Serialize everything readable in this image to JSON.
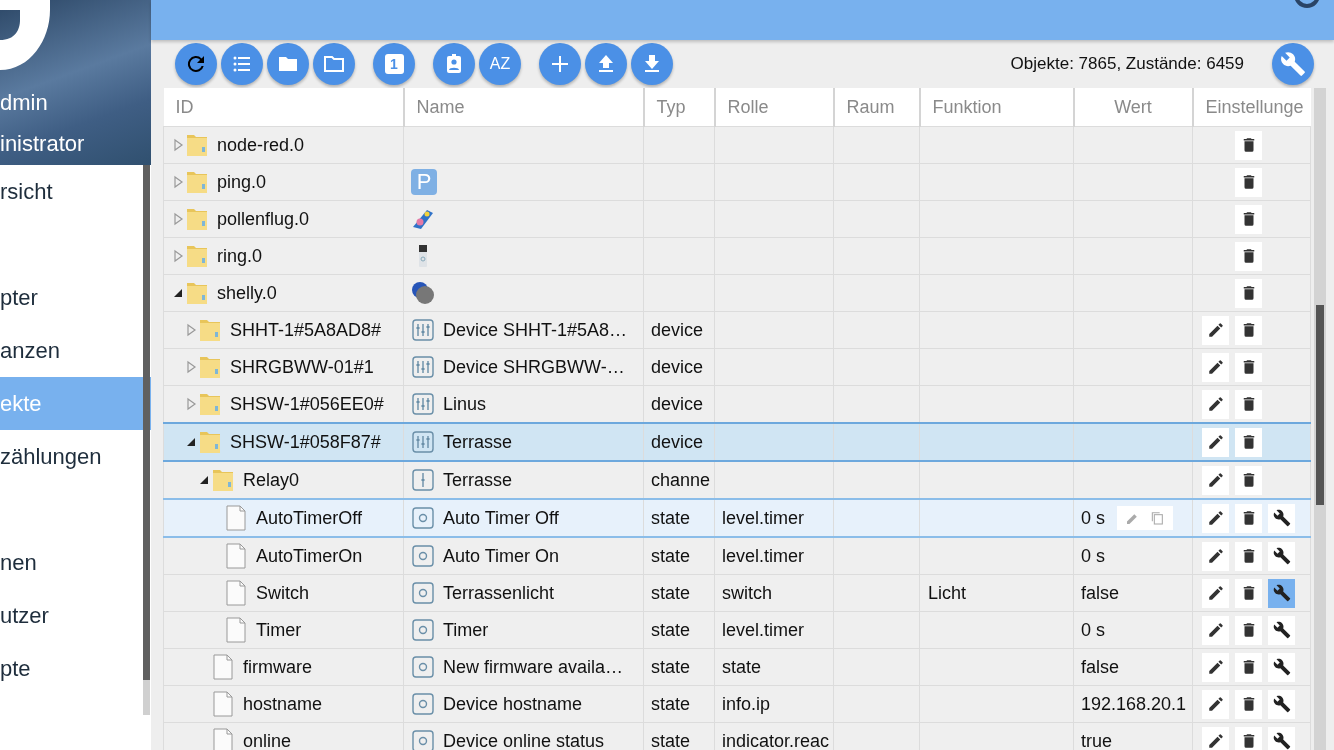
{
  "profile": {
    "name": "dmin",
    "role": "inistrator"
  },
  "menu": [
    {
      "label": "rsicht",
      "selected": false
    },
    {
      "selected": false
    },
    {
      "label": "pter",
      "selected": false
    },
    {
      "label": "anzen",
      "selected": false
    },
    {
      "label": "ekte",
      "selected": true
    },
    {
      "label": "zählungen",
      "selected": false
    },
    {
      "selected": false
    },
    {
      "label": "nen",
      "selected": false
    },
    {
      "label": "utzer",
      "selected": false
    },
    {
      "label": "pte",
      "selected": false
    }
  ],
  "toolbar": {
    "badge_label": "1",
    "sort_label": "AZ"
  },
  "stats": "Objekte: 7865, Zustände: 6459",
  "columns": [
    "ID",
    "Name",
    "Typ",
    "Rolle",
    "Raum",
    "Funktion",
    "Wert",
    "Einstellunge"
  ],
  "tree": [
    {
      "id": "node-red.0",
      "kind": "adapter",
      "expanded": false,
      "selected": false,
      "focused": false
    },
    {
      "id": "ping.0",
      "kind": "adapter",
      "expanded": false,
      "selected": false,
      "focused": false,
      "icon_label": "P"
    },
    {
      "id": "pollenflug.0",
      "kind": "adapter",
      "expanded": false,
      "selected": false,
      "focused": false
    },
    {
      "id": "ring.0",
      "kind": "adapter",
      "expanded": false,
      "selected": false,
      "focused": false
    },
    {
      "id": "shelly.0",
      "kind": "adapter",
      "expanded": true,
      "selected": false,
      "focused": false,
      "children": [
        {
          "id": "SHHT-1#5A8AD8#",
          "name": "Device SHHT-1#5A8…",
          "type": "device",
          "kind": "device",
          "expanded": false,
          "selected": false,
          "focused": false
        },
        {
          "id": "SHRGBWW-01#1",
          "name": "Device SHRGBWW-…",
          "type": "device",
          "kind": "device",
          "expanded": false,
          "selected": false,
          "focused": false
        },
        {
          "id": "SHSW-1#056EE0#",
          "name": "Linus",
          "type": "device",
          "kind": "device",
          "expanded": false,
          "selected": false,
          "focused": false
        },
        {
          "id": "SHSW-1#058F87#",
          "name": "Terrasse",
          "type": "device",
          "kind": "device",
          "expanded": true,
          "selected": true,
          "focused": false,
          "children": [
            {
              "id": "Relay0",
              "name": "Terrasse",
              "type": "channe",
              "kind": "channel",
              "expanded": true,
              "selected": false,
              "focused": false,
              "children": [
                {
                  "id": "AutoTimerOff",
                  "name": "Auto Timer Off",
                  "type": "state",
                  "role": "level.timer",
                  "value": "0 s",
                  "kind": "state",
                  "selected": false,
                  "focused": true,
                  "settings_highlighted": false
                },
                {
                  "id": "AutoTimerOn",
                  "name": "Auto Timer On",
                  "type": "state",
                  "role": "level.timer",
                  "value": "0 s",
                  "kind": "state",
                  "selected": false,
                  "focused": false,
                  "settings_highlighted": false
                },
                {
                  "id": "Switch",
                  "name": "Terrassenlicht",
                  "type": "state",
                  "role": "switch",
                  "function": "Licht",
                  "value": "false",
                  "kind": "state",
                  "selected": false,
                  "focused": false,
                  "settings_highlighted": true
                },
                {
                  "id": "Timer",
                  "name": "Timer",
                  "type": "state",
                  "role": "level.timer",
                  "value": "0 s",
                  "kind": "state",
                  "selected": false,
                  "focused": false,
                  "settings_highlighted": false
                }
              ]
            },
            {
              "id": "firmware",
              "name": "New firmware availa…",
              "type": "state",
              "role": "state",
              "value": "false",
              "kind": "state",
              "selected": false,
              "focused": false,
              "settings_highlighted": false
            },
            {
              "id": "hostname",
              "name": "Device hostname",
              "type": "state",
              "role": "info.ip",
              "value": "192.168.20.1",
              "kind": "state",
              "selected": false,
              "focused": false,
              "settings_highlighted": false
            },
            {
              "id": "online",
              "name": "Device online status",
              "type": "state",
              "role": "indicator.reac",
              "value": "true",
              "kind": "state",
              "selected": false,
              "focused": false,
              "settings_highlighted": false
            }
          ]
        }
      ]
    }
  ]
}
